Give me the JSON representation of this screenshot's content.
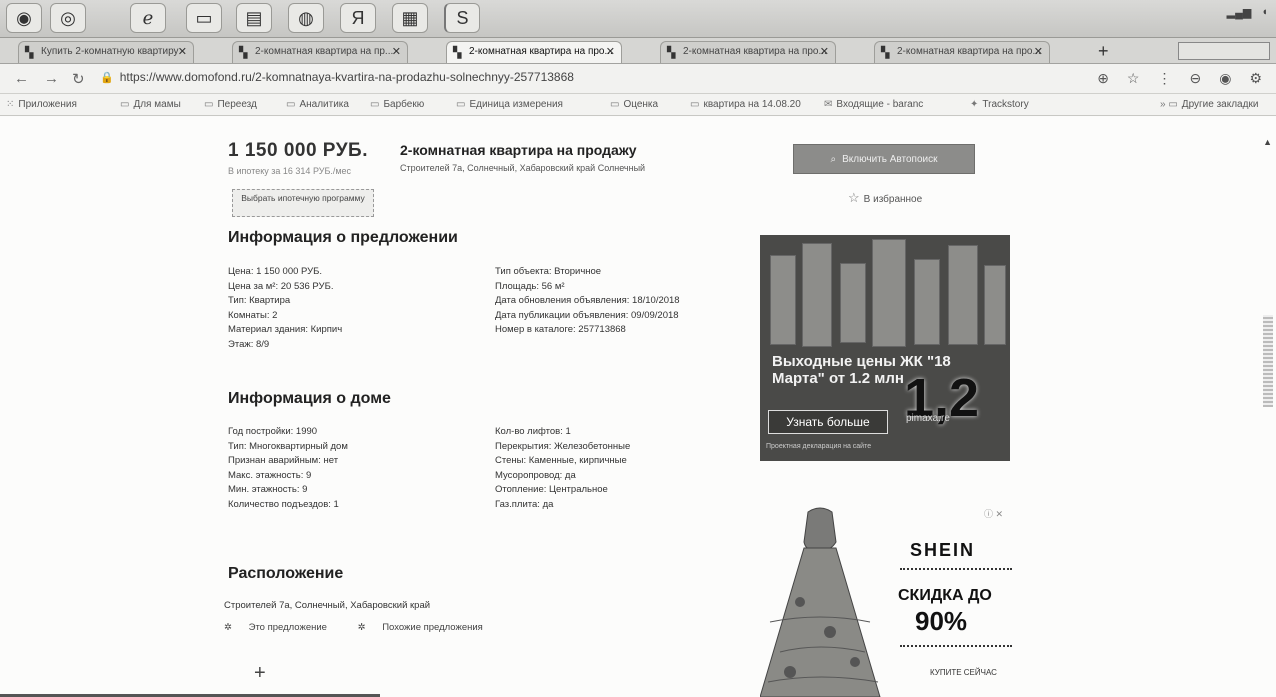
{
  "tabs": [
    {
      "label": "Купить 2-комнатную квартиру",
      "active": false
    },
    {
      "label": "2-комнатная квартира на пр...",
      "active": false
    },
    {
      "label": "2-комнатная квартира на про...",
      "active": true
    },
    {
      "label": "2-комнатная квартира на про...",
      "active": false
    },
    {
      "label": "2-комнатная квартира на про...",
      "active": false
    }
  ],
  "address_bar": {
    "url": "https://www.domofond.ru/2-komnatnaya-kvartira-na-prodazhu-solnechnyy-257713868"
  },
  "bookmarks": [
    {
      "label": "Приложения",
      "icon": "apps-grid-icon"
    },
    {
      "label": "Для мамы",
      "icon": "folder-icon"
    },
    {
      "label": "Переезд",
      "icon": "folder-icon"
    },
    {
      "label": "Аналитика",
      "icon": "folder-icon"
    },
    {
      "label": "Барбекю",
      "icon": "folder-icon"
    },
    {
      "label": "Единица измерения",
      "icon": "folder-icon"
    },
    {
      "label": "Оценка",
      "icon": "folder-icon"
    },
    {
      "label": "квартира на 14.08.20",
      "icon": "folder-icon"
    },
    {
      "label": "Входящие - baranc",
      "icon": "mail-icon"
    },
    {
      "label": "Trackstory",
      "icon": "bookmark-icon"
    }
  ],
  "bookmarks_more": "Другие закладки",
  "listing": {
    "price": "1 150 000 РУБ.",
    "price_note": "В ипотеку за 16 314 РУБ./мес",
    "mortgage_button": "Выбрать ипотечную программу",
    "title": "2-комнатная квартира на продажу",
    "address_short": "Строителей 7а, Солнечный, Хабаровский край Солнечный"
  },
  "offer_info": {
    "heading": "Информация о предложении",
    "left": [
      "Цена: 1 150 000 РУБ.",
      "Цена за м²: 20 536 РУБ.",
      "Тип: Квартира",
      "Комнаты: 2",
      "Материал здания: Кирпич",
      "Этаж: 8/9"
    ],
    "right": [
      "Тип объекта: Вторичное",
      "Площадь: 56 м²",
      "Дата обновления объявления: 18/10/2018",
      "Дата публикации объявления: 09/09/2018",
      "Номер в каталоге: 257713868"
    ]
  },
  "house_info": {
    "heading": "Информация о доме",
    "left": [
      "Год постройки: 1990",
      "Тип: Многоквартирный дом",
      "Признан аварийным: нет",
      "Макс. этажность: 9",
      "Мин. этажность: 9",
      "Количество подъездов: 1"
    ],
    "right": [
      "Кол-во лифтов: 1",
      "Перекрытия: Железобетонные",
      "Стены: Каменные, кирпичные",
      "Мусоропровод: да",
      "Отопление: Центральное",
      "Газ.плита: да"
    ]
  },
  "location": {
    "heading": "Расположение",
    "address": "Строителей 7а, Солнечный, Хабаровский край",
    "links": [
      "Это предложение",
      "Похожие предложения"
    ]
  },
  "sidebar": {
    "autosearch_button": "Включить Автопоиск",
    "favorites_link": "В избранное"
  },
  "ad1": {
    "headline": "Выходные цены ЖК \"18 Марта\" от 1.2 млн",
    "big_number": "1,2",
    "button": "Узнать больше",
    "site": "pimaxa.re",
    "footer": "Проектная декларация на сайте"
  },
  "ad2": {
    "brand": "SHEIN",
    "sale": "СКИДКА ДО",
    "percent": "90%",
    "cta": "КУПИТЕ СЕЙЧАС"
  },
  "colors": {
    "page_bg": "#fcfcfb",
    "ad_dark": "#4a4a48",
    "button_gray": "#8c8c8a"
  }
}
